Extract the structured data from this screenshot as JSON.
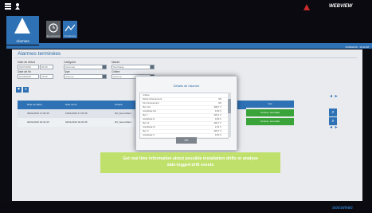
{
  "brand": {
    "top": "WEBVIEW",
    "bottom": "socomec"
  },
  "nav": {
    "main_tile_label": "Alarmes",
    "tile_clock_label": "Evenements",
    "tile_chart_label": "Tendances"
  },
  "datebar_text": "01/09/2016 - 10:12:28",
  "page_title": "Alarmes terminées",
  "filters": {
    "start_date_label": "Date de début",
    "start_date_value": "01/07/2016",
    "start_time_value": "00:00",
    "end_date_label": "Date de fin",
    "end_date_value": "01/09/2016",
    "end_time_value": "23:59",
    "category_label": "Catégorie",
    "category_value": "(Aucune)",
    "type_label": "Type",
    "type_value": "(Aucun)",
    "nature_label": "Nature",
    "nature_value": "Surcharge",
    "nature2_label": "Critère",
    "nature2_value": "(Aucun)"
  },
  "table": {
    "headers": [
      "Date de début",
      "Date de fin",
      "Produit",
      "Voir"
    ],
    "rows": [
      {
        "start": "30/01/2016 17:26:35",
        "end": "19/01/2016 17:26:35",
        "product": "D0_Serie-Maint",
        "status": "Tension, anomalie"
      },
      {
        "start": "02/01/2016 02:32:45",
        "end": "02/01/2016 02:30:35",
        "product": "D0_Serie-Maint",
        "status": "Tension, anomalie"
      }
    ]
  },
  "modal": {
    "title": "Détails de l'alarme",
    "rows": [
      {
        "k": "Critère",
        "v": ""
      },
      {
        "k": "Début d'évènement",
        "v": "0/0"
      },
      {
        "k": "Fin d'évènement",
        "v": "0/0"
      },
      {
        "k": "Ref. I12",
        "v": "308,7 V"
      },
      {
        "k": "Amplitude I12",
        "v": "0,40 V"
      },
      {
        "k": "Ref. I",
        "v": "245,1 V"
      },
      {
        "k": "Amplitude I1",
        "v": "0,00 V"
      },
      {
        "k": "Ref. I2",
        "v": "246,7 V"
      },
      {
        "k": "Amplitude I2",
        "v": "2,41 V"
      },
      {
        "k": "Ref. V",
        "v": "245,7 V"
      },
      {
        "k": "Amplitude V",
        "v": "0,00 V"
      }
    ],
    "ok_label": "OK"
  },
  "callout": {
    "line1": "Get real time information about possible installation drifts or analyse",
    "line2": "date-logged drift events"
  },
  "colors": {
    "accent": "#2e71b4",
    "callout": "#bfe06a",
    "status_green": "#3aa33a"
  }
}
